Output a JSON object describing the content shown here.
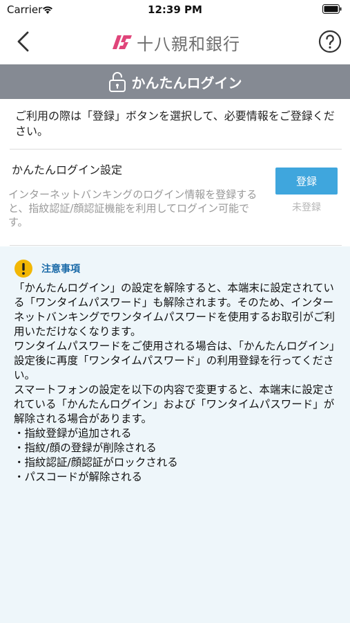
{
  "status_bar": {
    "carrier": "Carrier",
    "time": "12:39 PM"
  },
  "nav": {
    "brand_name": "十八親和銀行",
    "icons": {
      "back": "chevron-left-icon",
      "help": "question-circle-icon",
      "logo": "bank-logo-icon"
    }
  },
  "banner": {
    "title": "かんたんログイン",
    "icon": "lock-icon"
  },
  "intro": {
    "text": "ご利用の際は「登録」ボタンを選択して、必要情報をご登録ください。"
  },
  "setting": {
    "title": "かんたんログイン設定",
    "description": "インターネットバンキングのログイン情報を登録すると、指紋認証/顔認証機能を利用してログイン可能です。",
    "register_label": "登録",
    "status_label": "未登録"
  },
  "notice": {
    "title": "注意事項",
    "icon": "warning-icon",
    "paragraphs": [
      "「かんたんログイン」の設定を解除すると、本端末に設定されている「ワンタイムパスワード」も解除されます。そのため、インターネットバンキングでワンタイムパスワードを使用するお取引がご利用いただけなくなります。",
      "ワンタイムパスワードをご使用される場合は、「かんたんログイン」設定後に再度「ワンタイムパスワード」の利用登録を行ってください。",
      "スマートフォンの設定を以下の内容で変更すると、本端末に設定されている「かんたんログイン」および「ワンタイムパスワード」が解除される場合があります。",
      "・指紋登録が追加される",
      "・指紋/顔の登録が削除される",
      "・指紋認証/顔認証がロックされる",
      "・パスコードが解除される"
    ]
  },
  "colors": {
    "banner_bg": "#858a93",
    "button_bg": "#3fa6dd",
    "notice_bg": "#eef6fa",
    "notice_title": "#1a6aa8",
    "logo_pink": "#e0457a",
    "warning_yellow": "#f2b705"
  }
}
